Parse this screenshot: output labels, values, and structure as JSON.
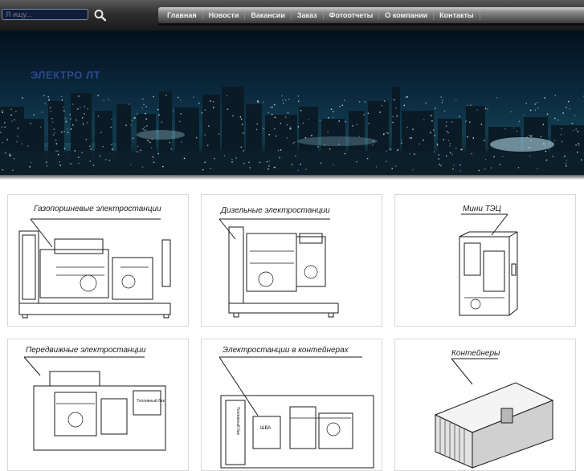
{
  "search": {
    "placeholder": "Я ищу..."
  },
  "nav": {
    "items": [
      "Главная",
      "Новости",
      "Вакансии",
      "Заказ",
      "Фотоотчеты",
      "О компании",
      "Контакты"
    ]
  },
  "banner": {
    "title": "ЭЛЕКТРО ЛТ"
  },
  "products": [
    {
      "label": "Газопоршневые электростанции"
    },
    {
      "label": "Дизельные электростанции"
    },
    {
      "label": "Мини ТЭЦ"
    },
    {
      "label": "Передвижные электростанции"
    },
    {
      "label": "Электростанции в контейнерах"
    },
    {
      "label": "Контейнеры"
    }
  ],
  "drawing_labels": {
    "fuel_box": "Топливный бак",
    "panel": "ШВА",
    "side_panel": "Топливный бак"
  }
}
